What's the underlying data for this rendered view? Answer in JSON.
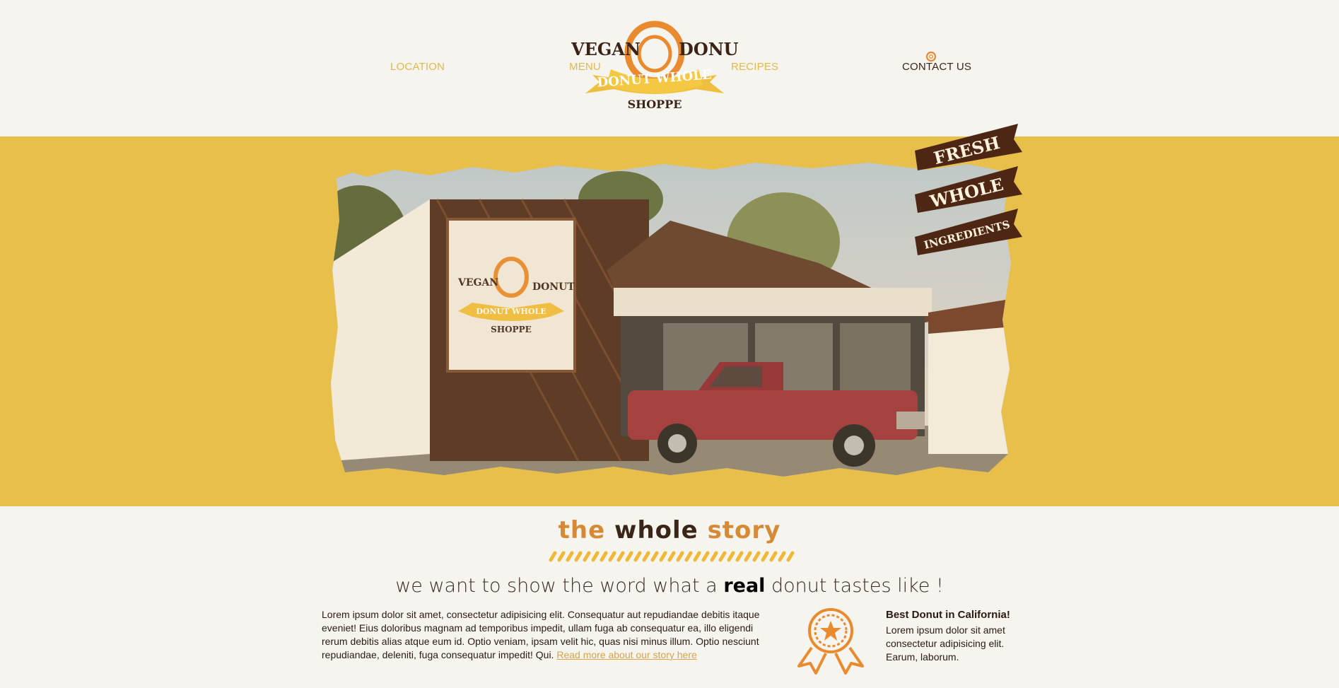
{
  "nav": {
    "location": "LOCATION",
    "menu": "MENU",
    "recipes": "RECIPES",
    "contact": "CONTACT US"
  },
  "logo": {
    "word_left": "VEGAN",
    "word_right": "DONUT",
    "banner": "DONUT WHOLE",
    "bottom": "SHOPPE"
  },
  "hero": {
    "photo_sign": {
      "word_left": "VEGAN",
      "word_right": "DONUT",
      "banner": "DONUT WHOLE",
      "bottom": "SHOPPE"
    },
    "ribbon": [
      "FRESH",
      "WHOLE",
      "INGREDIENTS"
    ]
  },
  "story": {
    "title_1": "the",
    "title_2": "whole",
    "title_3": "story",
    "tagline_before": "we want to show the word what a ",
    "tagline_bold": "real",
    "tagline_after": " donut tastes like !",
    "body": "Lorem ipsum dolor sit amet, consectetur adipisicing elit. Consequatur aut repudiandae debitis itaque eveniet! Eius doloribus magnam ad temporibus impedit, ullam fuga ab consequatur ea, illo eligendi rerum debitis alias atque eum id. Optio veniam, ipsam velit hic, quas nisi minus illum. Optio nesciunt repudiandae, deleniti, fuga consequatur impedit! Qui.",
    "read_more": "Read more about our story here"
  },
  "award": {
    "title": "Best Donut in California!",
    "body": "Lorem ipsum dolor sit amet consectetur adipisicing elit. Earum, laborum."
  },
  "colors": {
    "gold": "#e7bf4a",
    "orange": "#ea8a2e",
    "brown": "#4a2816",
    "page_bg": "#f6f4ee"
  }
}
